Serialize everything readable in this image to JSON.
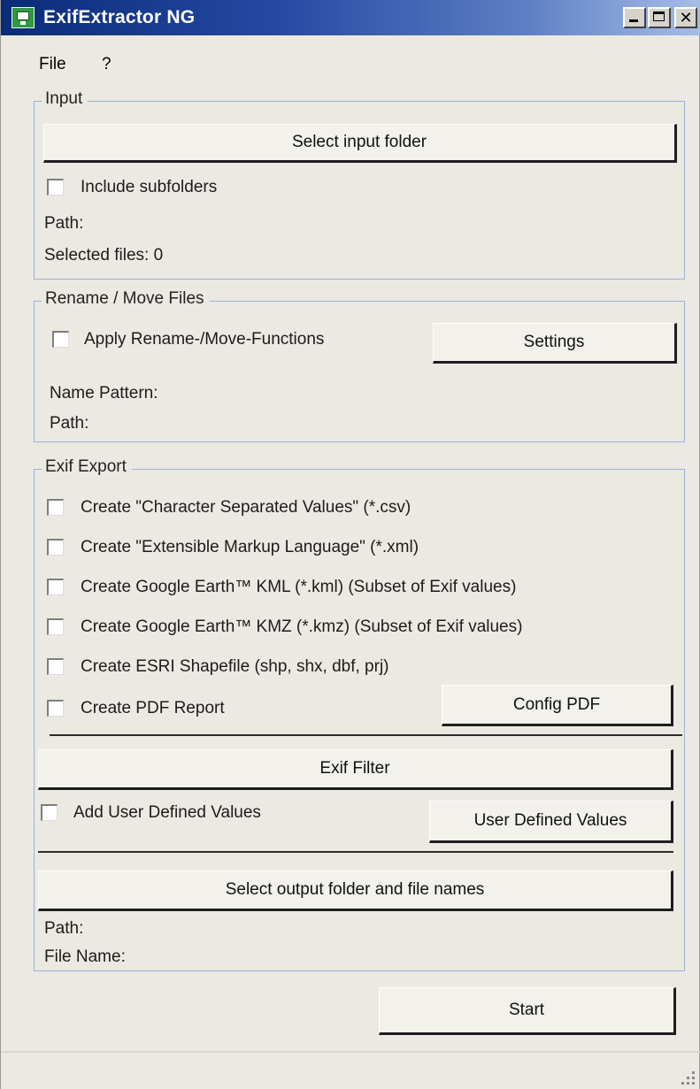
{
  "window": {
    "title": "ExifExtractor NG"
  },
  "menu": {
    "file": "File",
    "help": "?"
  },
  "input_group": {
    "legend": "Input",
    "select_folder_button": "Select input folder",
    "include_subfolders_label": "Include subfolders",
    "include_subfolders_checked": false,
    "path_label": "Path:",
    "selected_files_label": "Selected files: 0"
  },
  "rename_group": {
    "legend": "Rename / Move Files",
    "apply_label": "Apply Rename-/Move-Functions",
    "apply_checked": false,
    "settings_button": "Settings",
    "name_pattern_label": "Name Pattern:",
    "path_label": "Path:"
  },
  "export_group": {
    "legend": "Exif Export",
    "options": [
      {
        "label": "Create \"Character Separated Values\" (*.csv)",
        "checked": false
      },
      {
        "label": "Create \"Extensible Markup Language\" (*.xml)",
        "checked": false
      },
      {
        "label": "Create Google Earth™ KML (*.kml) (Subset of Exif values)",
        "checked": false
      },
      {
        "label": "Create Google Earth™ KMZ (*.kmz) (Subset of Exif values)",
        "checked": false
      },
      {
        "label": "Create ESRI Shapefile (shp, shx, dbf, prj)",
        "checked": false
      },
      {
        "label": "Create PDF Report",
        "checked": false
      }
    ],
    "config_pdf_button": "Config PDF",
    "exif_filter_button": "Exif Filter",
    "add_user_values_label": "Add User Defined Values",
    "add_user_values_checked": false,
    "user_values_button": "User Defined Values",
    "select_output_button": "Select output folder and file names",
    "path_label": "Path:",
    "file_name_label": "File Name:"
  },
  "start_button": "Start",
  "icons": {
    "app": "app-monitor-icon",
    "minimize": "minimize-icon",
    "maximize": "maximize-icon",
    "close": "close-icon",
    "resize": "resize-grip-icon"
  }
}
